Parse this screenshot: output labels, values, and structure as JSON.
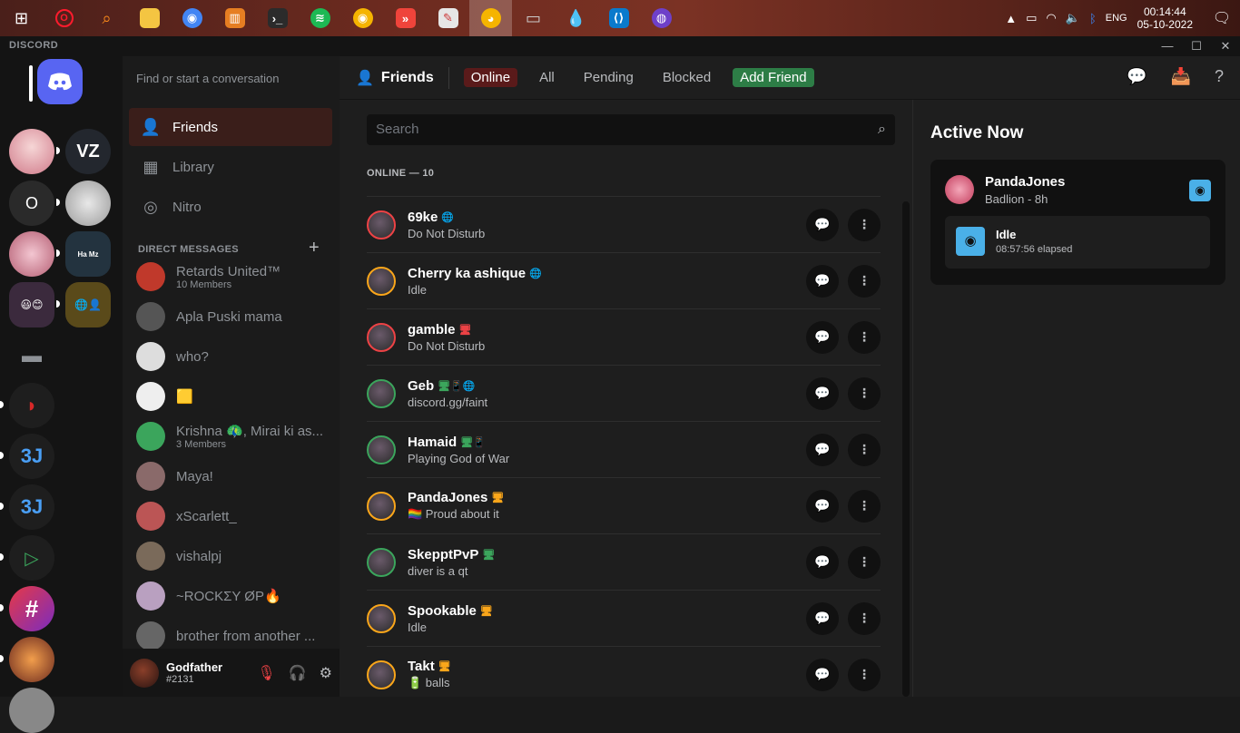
{
  "taskbar": {
    "icons": [
      "windows-start",
      "opera",
      "search",
      "file-explorer",
      "chrome",
      "sound-mixer",
      "terminal",
      "spotify",
      "chrome-canary",
      "anydesk",
      "paint",
      "discord",
      "usb",
      "water-drop",
      "vscode",
      "github-desktop"
    ],
    "tray": {
      "lang": "ENG",
      "time": "00:14:44",
      "date": "05-10-2022"
    }
  },
  "titlebar": {
    "brand": "DISCORD"
  },
  "sidebar": {
    "find_placeholder": "Find or start a conversation",
    "nav": [
      {
        "label": "Friends",
        "icon": "friends-icon"
      },
      {
        "label": "Library",
        "icon": "library-icon"
      },
      {
        "label": "Nitro",
        "icon": "nitro-icon"
      }
    ],
    "dm_header": "DIRECT MESSAGES",
    "dms": [
      {
        "name": "Retards United™",
        "sub": "10 Members",
        "color": "#c0392b"
      },
      {
        "name": "Apla Puski mama",
        "sub": "",
        "color": "#555"
      },
      {
        "name": "who?",
        "sub": "",
        "color": "#ddd"
      },
      {
        "name": "🟨",
        "sub": "",
        "color": "#eee"
      },
      {
        "name": "Krishna 🦚, Mirai ki as...",
        "sub": "3 Members",
        "color": "#3ba55c"
      },
      {
        "name": "Maya!",
        "sub": "",
        "color": "#8a6a6a"
      },
      {
        "name": "xScarlett_",
        "sub": "",
        "color": "#b55"
      },
      {
        "name": "vishalpj",
        "sub": "",
        "color": "#7a6a5a"
      },
      {
        "name": "~ROCKΣY ØP🔥",
        "sub": "",
        "color": "#b9a0c0"
      },
      {
        "name": "brother from another ...",
        "sub": "",
        "color": "#666"
      }
    ],
    "user": {
      "name": "Godfather",
      "tag": "#2131"
    }
  },
  "topbar": {
    "title": "Friends",
    "tabs": [
      "Online",
      "All",
      "Pending",
      "Blocked"
    ],
    "add_friend": "Add Friend"
  },
  "friends": {
    "search_placeholder": "Search",
    "online_header": "ONLINE — 10",
    "list": [
      {
        "name": "69ke",
        "status": "Do Not Disturb",
        "ring": "#ed4245",
        "devices": "🌐"
      },
      {
        "name": "Cherry ka ashique",
        "status": "Idle",
        "ring": "#faa61a",
        "devices": "🌐"
      },
      {
        "name": "gamble",
        "status": "Do Not Disturb",
        "ring": "#ed4245",
        "devices": "🖥"
      },
      {
        "name": "Geb",
        "status": "discord.gg/faint",
        "ring": "#3ba55c",
        "devices": "🖥📱🌐"
      },
      {
        "name": "Hamaid",
        "status": "Playing God of War",
        "ring": "#3ba55c",
        "devices": "🖥📱"
      },
      {
        "name": "PandaJones",
        "status": "🏳️‍🌈 Proud about it",
        "ring": "#faa61a",
        "devices": "🖥"
      },
      {
        "name": "SkepptPvP",
        "status": "diver is a qt",
        "ring": "#3ba55c",
        "devices": "🖥"
      },
      {
        "name": "Spookable",
        "status": "Idle",
        "ring": "#faa61a",
        "devices": "🖥"
      },
      {
        "name": "Takt",
        "status": "🔋 balls",
        "ring": "#faa61a",
        "devices": "🖥"
      }
    ]
  },
  "active_now": {
    "title": "Active Now",
    "user": "PandaJones",
    "sub": "Badlion - 8h",
    "activity": "Idle",
    "elapsed": "08:57:56 elapsed"
  }
}
